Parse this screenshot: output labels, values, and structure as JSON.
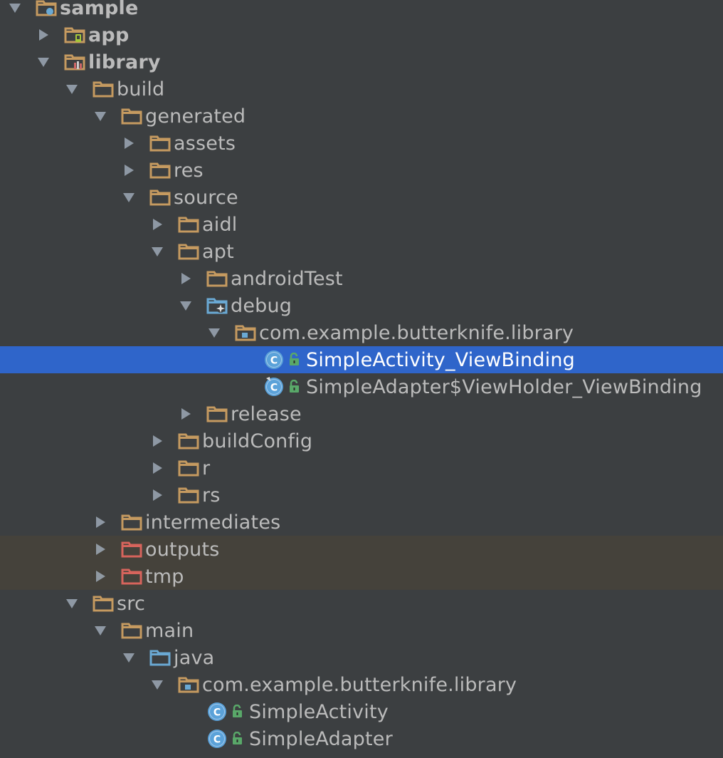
{
  "colors": {
    "background": "#3c3f41",
    "selected_row": "#2f65ca",
    "excluded_row": "#45423b",
    "folder": "#c59a60",
    "excluded_folder": "#d7645c",
    "source_folder": "#6aa9d4",
    "class_icon": "#5ba2d9",
    "lock": "#59a869",
    "text": "#bbbbbb"
  },
  "tree": [
    {
      "label": "sample",
      "depth": 0,
      "expanded": true,
      "icon": "module-icon",
      "bold": true
    },
    {
      "label": "app",
      "depth": 1,
      "expanded": false,
      "icon": "android-module-icon",
      "bold": true
    },
    {
      "label": "library",
      "depth": 1,
      "expanded": true,
      "icon": "library-module-icon",
      "bold": true
    },
    {
      "label": "build",
      "depth": 2,
      "expanded": true,
      "icon": "folder-icon"
    },
    {
      "label": "generated",
      "depth": 3,
      "expanded": true,
      "icon": "folder-icon"
    },
    {
      "label": "assets",
      "depth": 4,
      "expanded": false,
      "icon": "folder-icon"
    },
    {
      "label": "res",
      "depth": 4,
      "expanded": false,
      "icon": "folder-icon"
    },
    {
      "label": "source",
      "depth": 4,
      "expanded": true,
      "icon": "folder-icon"
    },
    {
      "label": "aidl",
      "depth": 5,
      "expanded": false,
      "icon": "folder-icon"
    },
    {
      "label": "apt",
      "depth": 5,
      "expanded": true,
      "icon": "folder-icon"
    },
    {
      "label": "androidTest",
      "depth": 6,
      "expanded": false,
      "icon": "folder-icon"
    },
    {
      "label": "debug",
      "depth": 6,
      "expanded": true,
      "icon": "generated-source-folder-icon"
    },
    {
      "label": "com.example.butterknife.library",
      "depth": 7,
      "expanded": true,
      "icon": "package-icon"
    },
    {
      "label": "SimpleActivity_ViewBinding",
      "depth": 8,
      "leaf": true,
      "icon": "class-icon",
      "lock": true,
      "selected": true
    },
    {
      "label": "SimpleAdapter$ViewHolder_ViewBinding",
      "depth": 8,
      "leaf": true,
      "icon": "class-generated-icon",
      "lock": true
    },
    {
      "label": "release",
      "depth": 6,
      "expanded": false,
      "icon": "folder-icon"
    },
    {
      "label": "buildConfig",
      "depth": 5,
      "expanded": false,
      "icon": "folder-icon"
    },
    {
      "label": "r",
      "depth": 5,
      "expanded": false,
      "icon": "folder-icon"
    },
    {
      "label": "rs",
      "depth": 5,
      "expanded": false,
      "icon": "folder-icon"
    },
    {
      "label": "intermediates",
      "depth": 3,
      "expanded": false,
      "icon": "folder-icon"
    },
    {
      "label": "outputs",
      "depth": 3,
      "expanded": false,
      "icon": "excluded-folder-icon",
      "excluded": true
    },
    {
      "label": "tmp",
      "depth": 3,
      "expanded": false,
      "icon": "excluded-folder-icon",
      "excluded": true
    },
    {
      "label": "src",
      "depth": 2,
      "expanded": true,
      "icon": "folder-icon"
    },
    {
      "label": "main",
      "depth": 3,
      "expanded": true,
      "icon": "folder-icon"
    },
    {
      "label": "java",
      "depth": 4,
      "expanded": true,
      "icon": "source-folder-icon"
    },
    {
      "label": "com.example.butterknife.library",
      "depth": 5,
      "expanded": true,
      "icon": "package-icon"
    },
    {
      "label": "SimpleActivity",
      "depth": 6,
      "leaf": true,
      "icon": "class-icon",
      "lock": true
    },
    {
      "label": "SimpleAdapter",
      "depth": 6,
      "leaf": true,
      "icon": "class-icon",
      "lock": true
    },
    {
      "label": "",
      "depth": 4,
      "expanded": false,
      "icon": "folder-icon",
      "partial": true
    }
  ]
}
